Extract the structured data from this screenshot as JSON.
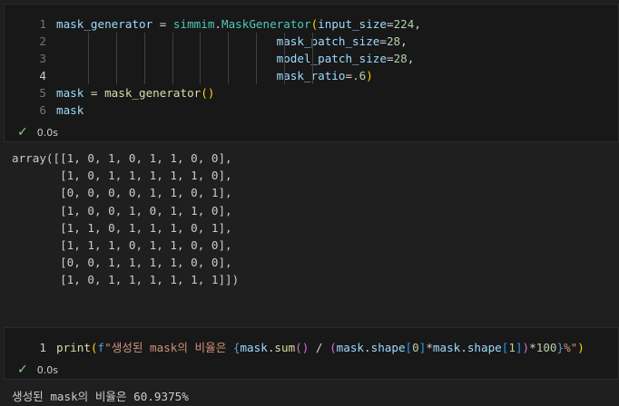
{
  "cell1": {
    "lines": [
      {
        "num": "1",
        "tokens": [
          {
            "t": "mask_generator",
            "c": "v"
          },
          {
            "t": " = ",
            "c": "o"
          },
          {
            "t": "simmim",
            "c": "c"
          },
          {
            "t": ".",
            "c": "o"
          },
          {
            "t": "MaskGenerator",
            "c": "c"
          },
          {
            "t": "(",
            "c": "b1"
          },
          {
            "t": "input_size",
            "c": "v"
          },
          {
            "t": "=",
            "c": "o"
          },
          {
            "t": "224",
            "c": "n"
          },
          {
            "t": ",",
            "c": "o"
          }
        ]
      },
      {
        "num": "2",
        "tokens": [
          {
            "t": "                                ",
            "c": "o"
          },
          {
            "t": "mask_patch_size",
            "c": "v"
          },
          {
            "t": "=",
            "c": "o"
          },
          {
            "t": "28",
            "c": "n"
          },
          {
            "t": ",",
            "c": "o"
          }
        ]
      },
      {
        "num": "3",
        "tokens": [
          {
            "t": "                                ",
            "c": "o"
          },
          {
            "t": "model_patch_size",
            "c": "v"
          },
          {
            "t": "=",
            "c": "o"
          },
          {
            "t": "28",
            "c": "n"
          },
          {
            "t": ",",
            "c": "o"
          }
        ]
      },
      {
        "num": "4",
        "active": true,
        "tokens": [
          {
            "t": "                                ",
            "c": "o"
          },
          {
            "t": "mask_ratio",
            "c": "v"
          },
          {
            "t": "=",
            "c": "o"
          },
          {
            "t": ".6",
            "c": "n"
          },
          {
            "t": ")",
            "c": "b1"
          }
        ]
      },
      {
        "num": "5",
        "tokens": [
          {
            "t": "mask",
            "c": "v"
          },
          {
            "t": " = ",
            "c": "o"
          },
          {
            "t": "mask_generator",
            "c": "f"
          },
          {
            "t": "()",
            "c": "b1"
          }
        ]
      },
      {
        "num": "6",
        "tokens": [
          {
            "t": "mask",
            "c": "v"
          }
        ]
      }
    ],
    "status_time": "0.0s"
  },
  "output1": "array([[1, 0, 1, 0, 1, 1, 0, 0],\n       [1, 0, 1, 1, 1, 1, 1, 0],\n       [0, 0, 0, 0, 1, 1, 0, 1],\n       [1, 0, 0, 1, 0, 1, 1, 0],\n       [1, 1, 0, 1, 1, 1, 0, 1],\n       [1, 1, 1, 0, 1, 1, 0, 0],\n       [0, 0, 1, 1, 1, 1, 0, 0],\n       [1, 0, 1, 1, 1, 1, 1, 1]])",
  "cell2": {
    "lines": [
      {
        "num": "1",
        "active": true,
        "tokens": [
          {
            "t": "print",
            "c": "f"
          },
          {
            "t": "(",
            "c": "b1"
          },
          {
            "t": "f",
            "c": "k"
          },
          {
            "t": "\"생성된 mask의 비율은 ",
            "c": "s"
          },
          {
            "t": "{",
            "c": "k"
          },
          {
            "t": "mask",
            "c": "v"
          },
          {
            "t": ".",
            "c": "o"
          },
          {
            "t": "sum",
            "c": "f"
          },
          {
            "t": "()",
            "c": "b2"
          },
          {
            "t": " / ",
            "c": "o"
          },
          {
            "t": "(",
            "c": "b2"
          },
          {
            "t": "mask",
            "c": "v"
          },
          {
            "t": ".",
            "c": "o"
          },
          {
            "t": "shape",
            "c": "v"
          },
          {
            "t": "[",
            "c": "b3"
          },
          {
            "t": "0",
            "c": "n"
          },
          {
            "t": "]",
            "c": "b3"
          },
          {
            "t": "*",
            "c": "o"
          },
          {
            "t": "mask",
            "c": "v"
          },
          {
            "t": ".",
            "c": "o"
          },
          {
            "t": "shape",
            "c": "v"
          },
          {
            "t": "[",
            "c": "b3"
          },
          {
            "t": "1",
            "c": "n"
          },
          {
            "t": "]",
            "c": "b3"
          },
          {
            "t": ")",
            "c": "b2"
          },
          {
            "t": "*",
            "c": "o"
          },
          {
            "t": "100",
            "c": "n"
          },
          {
            "t": "}",
            "c": "k"
          },
          {
            "t": "%\"",
            "c": "s"
          },
          {
            "t": ")",
            "c": "b1"
          }
        ]
      }
    ],
    "status_time": "0.0s"
  },
  "output2": "생성된 mask의 비율은 60.9375%",
  "icons": {
    "status": "check-icon"
  },
  "colors": {
    "background": "#1f1f1f",
    "cell": "#181818",
    "check": "#89d185"
  }
}
